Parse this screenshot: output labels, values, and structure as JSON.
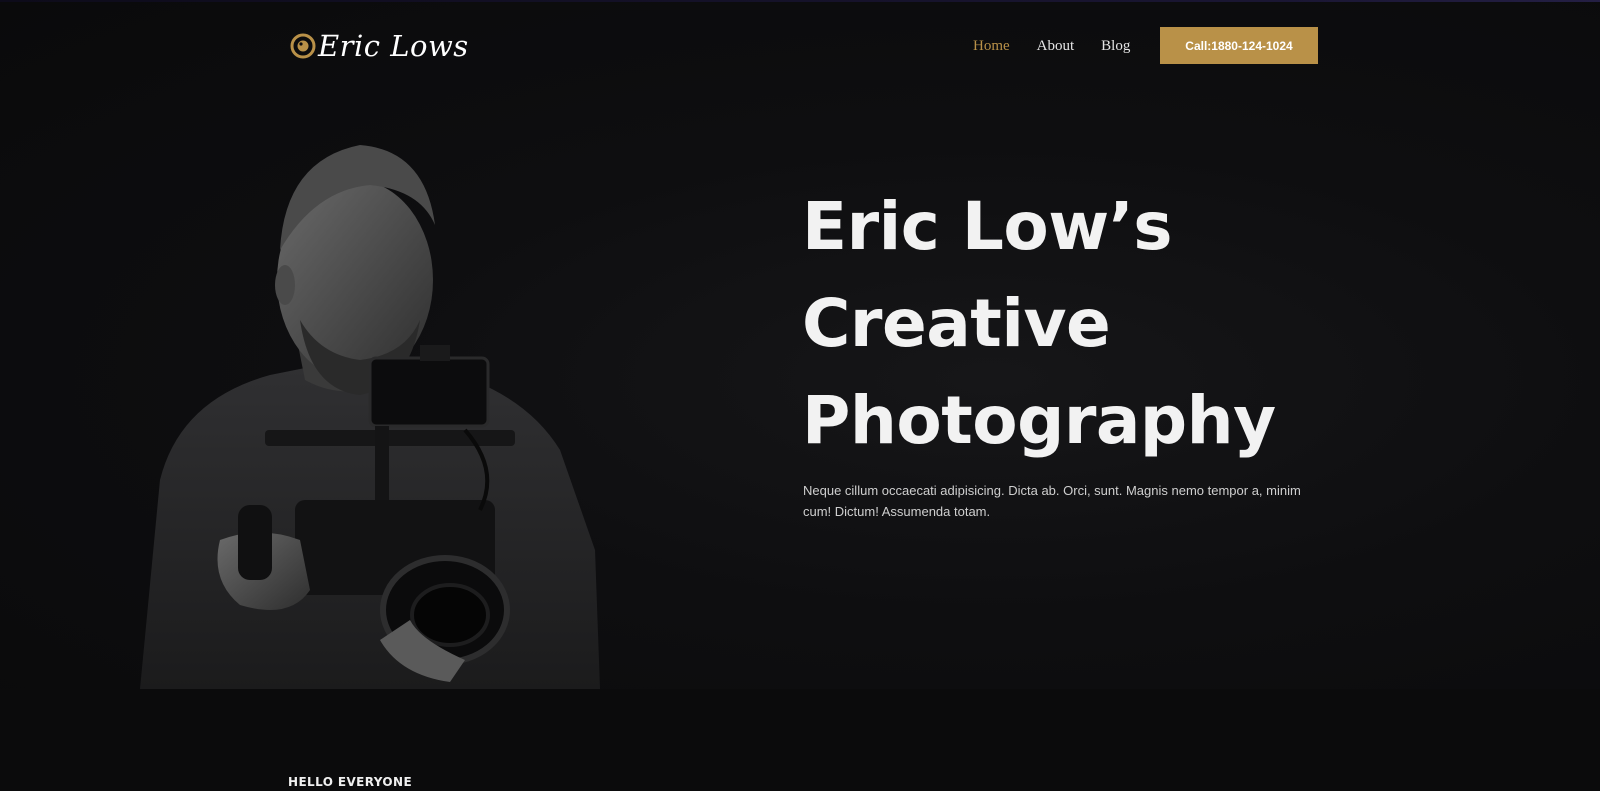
{
  "header": {
    "logo_text": "Eric Lows",
    "nav": [
      {
        "label": "Home",
        "active": true
      },
      {
        "label": "About",
        "active": false
      },
      {
        "label": "Blog",
        "active": false
      }
    ],
    "call_button": "Call:1880-124-1024"
  },
  "hero": {
    "title_lines": [
      "Eric Low’s",
      "Creative",
      "Photography"
    ],
    "description": "Neque cillum occaecati adipisicing. Dicta ab. Orci, sunt. Magnis nemo tempor a, minim cum! Dictum! Assumenda totam."
  },
  "section": {
    "eyebrow": "HELLO EVERYONE"
  },
  "colors": {
    "accent": "#b99148",
    "background": "#0a0a0b",
    "text": "#f2f2f2"
  },
  "icons": {
    "logo": "camera-lens-icon"
  }
}
